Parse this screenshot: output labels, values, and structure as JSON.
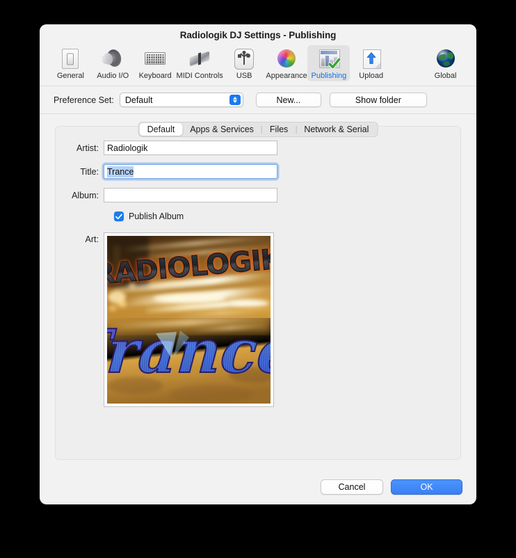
{
  "window": {
    "title": "Radiologik DJ Settings - Publishing"
  },
  "toolbar": {
    "items": [
      {
        "label": "General",
        "icon": "general-icon",
        "selected": false
      },
      {
        "label": "Audio I/O",
        "icon": "speaker-icon",
        "selected": false
      },
      {
        "label": "Keyboard",
        "icon": "keyboard-icon",
        "selected": false
      },
      {
        "label": "MIDI Controls",
        "icon": "midi-icon",
        "selected": false
      },
      {
        "label": "USB",
        "icon": "usb-icon",
        "selected": false
      },
      {
        "label": "Appearance",
        "icon": "colorwheel-icon",
        "selected": false
      },
      {
        "label": "Publishing",
        "icon": "publishing-icon",
        "selected": true
      },
      {
        "label": "Upload",
        "icon": "upload-icon",
        "selected": false
      },
      {
        "label": "Global",
        "icon": "globe-icon",
        "selected": false
      }
    ],
    "selected_label_color": "#0a72ef"
  },
  "preference_set": {
    "label": "Preference Set:",
    "value": "Default",
    "options": [
      "Default"
    ],
    "new_button": "New...",
    "show_folder_button": "Show folder"
  },
  "tabs": [
    {
      "label": "Default",
      "active": true
    },
    {
      "label": "Apps & Services",
      "active": false
    },
    {
      "label": "Files",
      "active": false
    },
    {
      "label": "Network & Serial",
      "active": false
    }
  ],
  "form": {
    "artist": {
      "label": "Artist:",
      "value": "Radiologik",
      "placeholder": ""
    },
    "title": {
      "label": "Title:",
      "value": "Trance",
      "placeholder": "",
      "focused": true,
      "selected": true
    },
    "album": {
      "label": "Album:",
      "value": "",
      "placeholder": ""
    },
    "publish_album": {
      "label": "Publish Album",
      "checked": true
    },
    "art": {
      "label": "Art:",
      "top_text": "RADIOLOGIK",
      "bottom_text": "Trance",
      "description": "album-artwork"
    }
  },
  "footer": {
    "cancel": "Cancel",
    "ok": "OK"
  },
  "colors": {
    "accent": "#1a7bf0",
    "ok_button": "#3b7ff5",
    "selected_tab_text": "#0a72ef",
    "panel_bg": "#eeeeee",
    "window_bg": "#f2f2f2",
    "selection_highlight": "#b4d1f5"
  }
}
